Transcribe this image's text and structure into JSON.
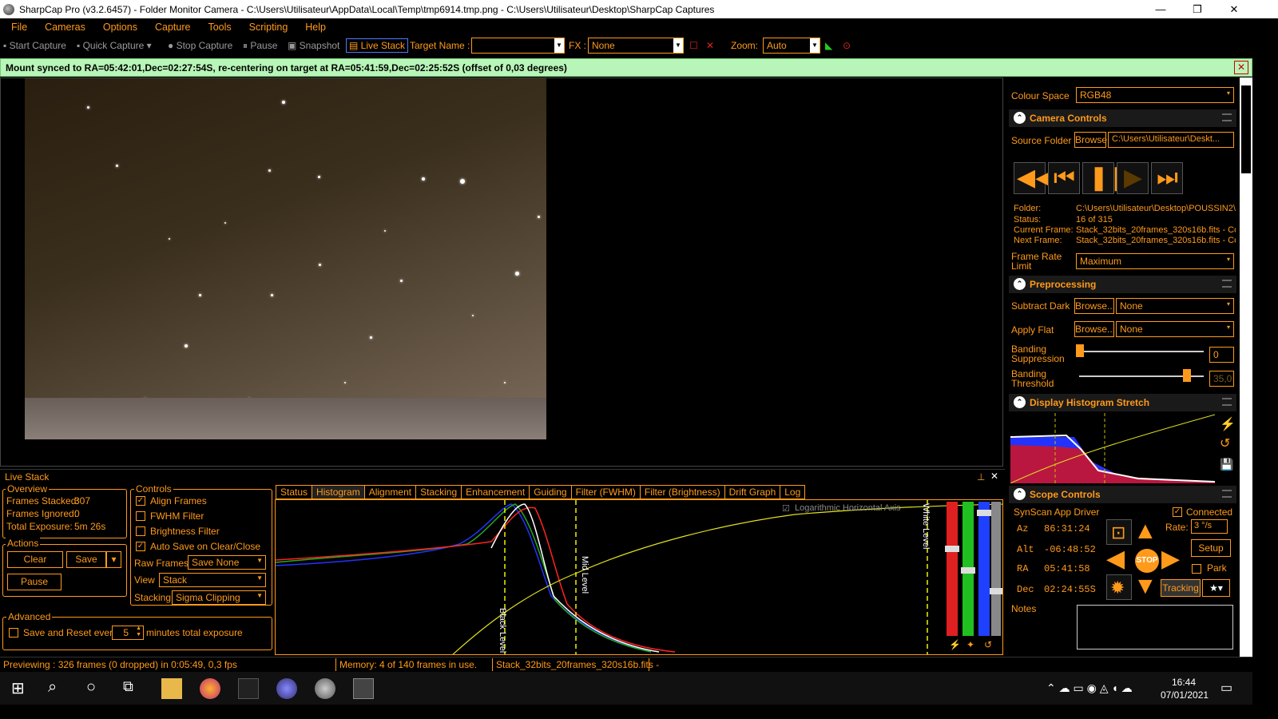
{
  "window": {
    "title": "SharpCap Pro (v3.2.6457) - Folder Monitor Camera - C:\\Users\\Utilisateur\\AppData\\Local\\Temp\\tmp6914.tmp.png - C:\\Users\\Utilisateur\\Desktop\\SharpCap Captures",
    "minimize": "—",
    "maximize": "❐",
    "close": "✕"
  },
  "menu": [
    "File",
    "Cameras",
    "Options",
    "Capture",
    "Tools",
    "Scripting",
    "Help"
  ],
  "toolbar": {
    "start_capture": "Start Capture",
    "quick_capture": "Quick Capture",
    "stop_capture": "Stop Capture",
    "pause": "Pause",
    "snapshot": "Snapshot",
    "live_stack": "Live Stack",
    "target_name_label": "Target Name :",
    "target_name_value": "",
    "fx_label": "FX :",
    "fx_value": "None",
    "zoom_label": "Zoom:",
    "zoom_value": "Auto"
  },
  "notification": "Mount synced to RA=05:42:01,Dec=02:27:54S, re-centering on target at RA=05:41:59,Dec=02:25:52S (offset of 0,03 degrees)",
  "live_stack": {
    "title": "Live Stack",
    "overview_title": "Overview",
    "frames_stacked_label": "Frames Stacked:",
    "frames_stacked": "307",
    "frames_ignored_label": "Frames Ignored:",
    "frames_ignored": "0",
    "total_exposure_label": "Total Exposure:",
    "total_exposure": "5m 26s",
    "actions_title": "Actions",
    "clear": "Clear",
    "save": "Save",
    "pause": "Pause",
    "controls_title": "Controls",
    "align_frames": "Align Frames",
    "fwhm_filter": "FWHM Filter",
    "brightness_filter": "Brightness Filter",
    "auto_save": "Auto Save on Clear/Close",
    "raw_frames_label": "Raw Frames",
    "raw_frames_value": "Save None",
    "view_label": "View",
    "view_value": "Stack",
    "stacking_label": "Stacking",
    "stacking_value": "Sigma Clipping",
    "advanced_title": "Advanced",
    "save_reset_label": "Save and Reset every",
    "save_reset_value": "5",
    "minutes_label": "minutes total exposure",
    "tabs": [
      "Status",
      "Histogram",
      "Alignment",
      "Stacking",
      "Enhancement",
      "Guiding",
      "Filter (FWHM)",
      "Filter (Brightness)",
      "Drift Graph",
      "Log"
    ],
    "log_axis_label": "Logarithmic Horizontal Axis",
    "black_level": "Black Level",
    "mid_level": "Mid Level",
    "white_level": "White Level"
  },
  "status": {
    "previewing": "Previewing : 326 frames (0 dropped) in 0:05:49, 0,3 fps",
    "memory": "Memory: 4 of 140 frames in use.",
    "file": "Stack_32bits_20frames_320s16b.fits -"
  },
  "right_panel": {
    "colour_space_label": "Colour Space",
    "colour_space_value": "RGB48",
    "camera_controls_title": "Camera Controls",
    "source_folder_label": "Source Folder",
    "browse": "Browse",
    "source_folder_value": "C:\\Users\\Utilisateur\\Deskt...",
    "folder_label": "Folder:",
    "folder_value": "C:\\Users\\Utilisateur\\Desktop\\POUSSIN2\\",
    "status_label": "Status:",
    "status_value": "16 of 315",
    "current_frame_label": "Current Frame:",
    "current_frame_value": "Stack_32bits_20frames_320s16b.fits - Co",
    "next_frame_label": "Next Frame:",
    "next_frame_value": "Stack_32bits_20frames_320s16b.fits - Co",
    "frame_rate_label": "Frame Rate Limit",
    "frame_rate_value": "Maximum",
    "preprocessing_title": "Preprocessing",
    "subtract_dark_label": "Subtract Dark",
    "browse_ellipsis": "Browse...",
    "subtract_dark_value": "None",
    "apply_flat_label": "Apply Flat",
    "apply_flat_value": "None",
    "banding_suppression_label": "Banding Suppression",
    "banding_suppression_value": "0",
    "banding_threshold_label": "Banding Threshold",
    "banding_threshold_value": "35,0",
    "histogram_stretch_title": "Display Histogram Stretch",
    "scope_controls_title": "Scope Controls",
    "driver": "SynScan App Driver",
    "connected": "Connected",
    "az_label": "Az",
    "az_value": "86:31:24",
    "alt_label": "Alt",
    "alt_value": "-06:48:52",
    "ra_label": "RA",
    "ra_value": "05:41:58",
    "dec_label": "Dec",
    "dec_value": "02:24:55S",
    "rate_label": "Rate:",
    "rate_value": "3 °/s",
    "setup": "Setup",
    "park": "Park",
    "stop": "STOP",
    "tracking": "Tracking",
    "notes_label": "Notes"
  },
  "taskbar": {
    "time": "16:44",
    "date": "07/01/2021"
  },
  "colors": {
    "accent": "#ff9a1a",
    "notify_bg": "#b8f5b8"
  }
}
